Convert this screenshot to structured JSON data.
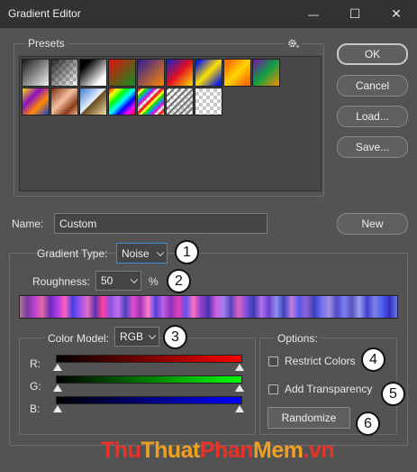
{
  "window": {
    "title": "Gradient Editor",
    "controls": {
      "minimize": "—",
      "maximize": "☐",
      "close": "✕"
    }
  },
  "presets": {
    "label": "Presets",
    "menu_icon": "gear-icon",
    "swatches": [
      {
        "name": "foreground-to-background",
        "background": "linear-gradient(135deg,#1a1a1a 0%,#f2f2f2 100%)"
      },
      {
        "name": "foreground-to-transparent",
        "background": "linear-gradient(135deg,rgba(20,20,20,0.9) 0%,rgba(20,20,20,0) 100%)",
        "checker": true
      },
      {
        "name": "black-white",
        "background": "linear-gradient(135deg,#000 20%,#fff 80%)"
      },
      {
        "name": "red-green",
        "background": "linear-gradient(135deg,#e01010 0%,#109020 100%)"
      },
      {
        "name": "violet-orange",
        "background": "linear-gradient(135deg,#2a1a9a 0%,#ff8a00 100%)"
      },
      {
        "name": "blue-red-yellow",
        "background": "linear-gradient(135deg,#1020d0 0%,#e01020 50%,#ffe000 100%)"
      },
      {
        "name": "blue-yellow-blue",
        "background": "linear-gradient(135deg,#1020e0 10%,#ffe000 50%,#1020e0 90%)"
      },
      {
        "name": "orange-yellow-orange",
        "background": "linear-gradient(135deg,#ff6a00 10%,#ffd400 50%,#ff6a00 90%)"
      },
      {
        "name": "violet-green-orange",
        "background": "linear-gradient(135deg,#7a10b0 0%,#10a040 50%,#ff8a00 100%)"
      },
      {
        "name": "yellow-violet-orange-blue",
        "background": "linear-gradient(135deg,#ffe000 0%,#8a10c0 35%,#ff8a00 65%,#1040e0 100%)"
      },
      {
        "name": "copper",
        "background": "linear-gradient(135deg,#7a3010 0%,#f4c0a0 45%,#8a3a18 75%,#f0b090 100%)"
      },
      {
        "name": "chrome",
        "background": "linear-gradient(135deg,#3a7ad0 0%,#e8f0ff 48%,#6a4a20 52%,#f0e0a0 100%)"
      },
      {
        "name": "spectrum",
        "background": "linear-gradient(135deg,#ff0000,#ffff00,#00ff00,#00ffff,#0000ff,#ff00ff,#ff0000)"
      },
      {
        "name": "transparent-rainbow",
        "background": "repeating-linear-gradient(135deg,rgba(255,0,0,0.85) 0 3px,rgba(255,255,0,0.85) 3px 6px,rgba(0,200,0,0.85) 6px 9px,rgba(0,120,255,0.85) 9px 12px,rgba(200,0,200,0.85) 12px 15px,rgba(255,255,255,0.2) 15px 18px)",
        "checker": true
      },
      {
        "name": "transparent-stripes",
        "background": "repeating-linear-gradient(135deg,rgba(110,110,110,0.95) 0 2px,rgba(255,255,255,0) 2px 5px)",
        "checker": true
      },
      {
        "name": "transparent",
        "background": "linear-gradient(0deg,rgba(255,255,255,0),rgba(255,255,255,0))",
        "checker": true
      }
    ]
  },
  "buttons": {
    "ok": "OK",
    "cancel": "Cancel",
    "load": "Load...",
    "save": "Save...",
    "new": "New",
    "randomize": "Randomize"
  },
  "name_field": {
    "label": "Name:",
    "value": "Custom"
  },
  "gradient_type": {
    "label": "Gradient Type:",
    "value": "Noise"
  },
  "roughness": {
    "label": "Roughness:",
    "value": "50",
    "unit": "%"
  },
  "noise_preview": {
    "background": "linear-gradient(90deg,#a87a9a 0%,#7a3aa0 2%,#c040d8 4%,#e06aa0 6%,#6a2ac0 8%,#b03ae0 10%,#ff60c0 12%,#4040e0 14%,#a050f0 16%,#e070c0 18%,#6030b0 20%,#ff40a0 22%,#8a50e0 24%,#c070f0 26%,#4a40c0 28%,#e050d0 30%,#a030b0 32%,#ff80d0 34%,#5040e0 36%,#c060e0 38%,#8a30c0 40%,#e040b0 42%,#6050f0 44%,#ff70c0 46%,#9040d0 48%,#4a30b0 50%,#d060e0 52%,#a080f0 54%,#5a40c0 56%,#e060c0 58%,#7a50e0 60%,#3a3ab0 62%,#b070f0 64%,#6a40d0 66%,#9090f0 68%,#4040c0 70%,#c080e0 72%,#5a5af0 74%,#8a60d0 76%,#3a40c0 78%,#7070f0 80%,#a090e0 82%,#4a4ad0 84%,#8080f0 86%,#5a50c0 88%,#9aa0f0 90%,#4040d0 92%,#7a80e0 94%,#5060f0 96%,#3030c0 98%,#6a7ae0 100%)"
  },
  "color_model": {
    "label": "Color Model:",
    "value": "RGB",
    "channels": [
      {
        "label": "R:",
        "gradient": "linear-gradient(90deg,#000 0%,#ff0000 100%)",
        "min": 0,
        "max": 1
      },
      {
        "label": "G:",
        "gradient": "linear-gradient(90deg,#000 0%,#00ff00 100%)",
        "min": 0,
        "max": 1
      },
      {
        "label": "B:",
        "gradient": "linear-gradient(90deg,#000 0%,#0000ff 100%)",
        "min": 0,
        "max": 1
      }
    ]
  },
  "options": {
    "label": "Options:",
    "restrict_colors": {
      "label": "Restrict Colors",
      "checked": false
    },
    "add_transparency": {
      "label": "Add Transparency",
      "checked": false
    }
  },
  "callouts": [
    "1",
    "2",
    "3",
    "4",
    "5",
    "6"
  ],
  "watermark": {
    "parts": [
      {
        "text": "Thu",
        "color": "#e8322a"
      },
      {
        "text": "Thuat",
        "color": "#f0a020"
      },
      {
        "text": "Phan",
        "color": "#e8322a"
      },
      {
        "text": "Mem",
        "color": "#f0a020"
      },
      {
        "text": ".vn",
        "color": "#e8322a"
      }
    ]
  }
}
